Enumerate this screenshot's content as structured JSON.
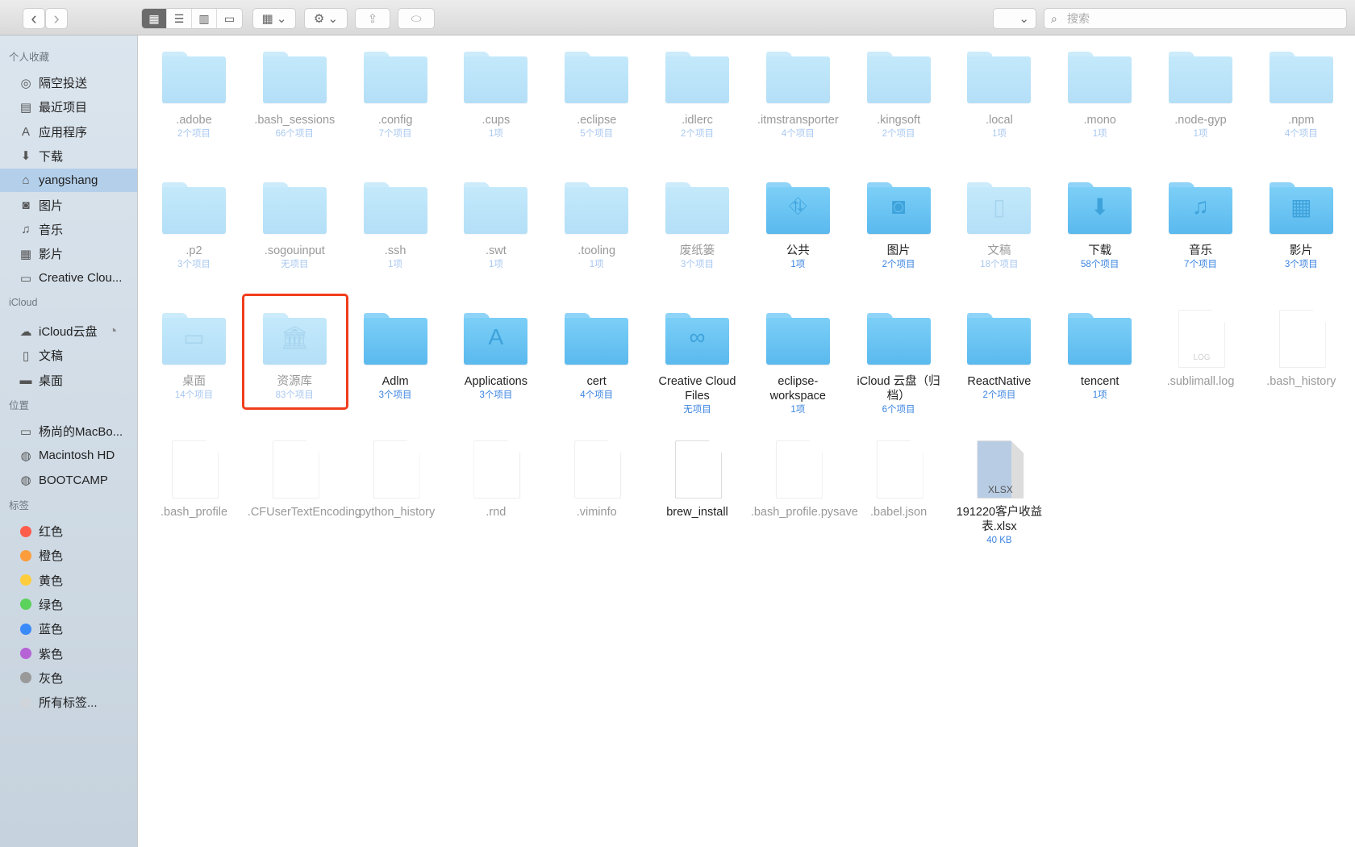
{
  "toolbar": {
    "back": "‹",
    "forward": "›",
    "views": [
      "icon-view",
      "list-view",
      "column-view",
      "gallery-view"
    ],
    "search_placeholder": "搜索"
  },
  "sidebar": {
    "sections": [
      {
        "title": "个人收藏",
        "items": [
          {
            "label": "隔空投送",
            "icon": "airdrop-icon",
            "glyph": "◎"
          },
          {
            "label": "最近项目",
            "icon": "recents-icon",
            "glyph": "▤"
          },
          {
            "label": "应用程序",
            "icon": "applications-icon",
            "glyph": "A"
          },
          {
            "label": "下载",
            "icon": "download-icon",
            "glyph": "⬇"
          },
          {
            "label": "yangshang",
            "icon": "home-icon",
            "glyph": "⌂",
            "selected": true
          },
          {
            "label": "图片",
            "icon": "camera-icon",
            "glyph": "◙"
          },
          {
            "label": "音乐",
            "icon": "music-icon",
            "glyph": "♫"
          },
          {
            "label": "影片",
            "icon": "film-icon",
            "glyph": "▦"
          },
          {
            "label": "Creative Clou...",
            "icon": "folder-icon",
            "glyph": "▭"
          }
        ]
      },
      {
        "title": "iCloud",
        "items": [
          {
            "label": "iCloud云盘",
            "icon": "cloud-icon",
            "glyph": "☁",
            "progress": true
          },
          {
            "label": "文稿",
            "icon": "document-icon",
            "glyph": "▯"
          },
          {
            "label": "桌面",
            "icon": "desktop-icon",
            "glyph": "▬"
          }
        ]
      },
      {
        "title": "位置",
        "items": [
          {
            "label": "杨尚的MacBo...",
            "icon": "laptop-icon",
            "glyph": "▭"
          },
          {
            "label": "Macintosh HD",
            "icon": "disk-icon",
            "glyph": "◍"
          },
          {
            "label": "BOOTCAMP",
            "icon": "disk-icon",
            "glyph": "◍"
          }
        ]
      },
      {
        "title": "标签",
        "items": [
          {
            "label": "红色",
            "color": "#fe5d4c"
          },
          {
            "label": "橙色",
            "color": "#fb9d3d"
          },
          {
            "label": "黄色",
            "color": "#fdcd3c"
          },
          {
            "label": "绿色",
            "color": "#5ad25b"
          },
          {
            "label": "蓝色",
            "color": "#3a8afa"
          },
          {
            "label": "紫色",
            "color": "#b663d6"
          },
          {
            "label": "灰色",
            "color": "#999999"
          },
          {
            "label": "所有标签...",
            "color": "#cfd5da"
          }
        ]
      }
    ]
  },
  "files": [
    {
      "name": ".adobe",
      "count": "2个项目",
      "kind": "folder",
      "dim": true
    },
    {
      "name": ".bash_sessions",
      "count": "66个项目",
      "kind": "folder",
      "dim": true
    },
    {
      "name": ".config",
      "count": "7个项目",
      "kind": "folder",
      "dim": true
    },
    {
      "name": ".cups",
      "count": "1项",
      "kind": "folder",
      "dim": true
    },
    {
      "name": ".eclipse",
      "count": "5个项目",
      "kind": "folder",
      "dim": true
    },
    {
      "name": ".idlerc",
      "count": "2个项目",
      "kind": "folder",
      "dim": true
    },
    {
      "name": ".itmstransporter",
      "count": "4个项目",
      "kind": "folder",
      "dim": true
    },
    {
      "name": ".kingsoft",
      "count": "2个项目",
      "kind": "folder",
      "dim": true
    },
    {
      "name": ".local",
      "count": "1项",
      "kind": "folder",
      "dim": true
    },
    {
      "name": ".mono",
      "count": "1项",
      "kind": "folder",
      "dim": true
    },
    {
      "name": ".node-gyp",
      "count": "1项",
      "kind": "folder",
      "dim": true
    },
    {
      "name": ".npm",
      "count": "4个项目",
      "kind": "folder",
      "dim": true
    },
    {
      "name": "",
      "count": "",
      "kind": "none"
    },
    {
      "name": ".p2",
      "count": "3个项目",
      "kind": "folder",
      "dim": true
    },
    {
      "name": ".sogouinput",
      "count": "无项目",
      "kind": "folder",
      "dim": true
    },
    {
      "name": ".ssh",
      "count": "1项",
      "kind": "folder",
      "dim": true
    },
    {
      "name": ".swt",
      "count": "1项",
      "kind": "folder",
      "dim": true
    },
    {
      "name": ".tooling",
      "count": "1项",
      "kind": "folder",
      "dim": true
    },
    {
      "name": "废纸篓",
      "count": "3个项目",
      "kind": "folder",
      "dim": true
    },
    {
      "name": "公共",
      "count": "1项",
      "kind": "folder",
      "glyph": "⛗",
      "icon": "public-folder-icon"
    },
    {
      "name": "图片",
      "count": "2个项目",
      "kind": "folder",
      "glyph": "◙",
      "icon": "pictures-folder-icon"
    },
    {
      "name": "文稿",
      "count": "18个项目",
      "kind": "folder",
      "dim": true,
      "glyph": "▯",
      "icon": "documents-folder-icon"
    },
    {
      "name": "下载",
      "count": "58个项目",
      "kind": "folder",
      "glyph": "⬇",
      "icon": "downloads-folder-icon"
    },
    {
      "name": "音乐",
      "count": "7个项目",
      "kind": "folder",
      "glyph": "♫",
      "icon": "music-folder-icon"
    },
    {
      "name": "影片",
      "count": "3个项目",
      "kind": "folder",
      "glyph": "▦",
      "icon": "movies-folder-icon"
    },
    {
      "name": "",
      "count": "",
      "kind": "none"
    },
    {
      "name": "桌面",
      "count": "14个项目",
      "kind": "folder",
      "dim": true,
      "glyph": "▭",
      "icon": "desktop-folder-icon"
    },
    {
      "name": "资源库",
      "count": "83个项目",
      "kind": "folder",
      "dim": true,
      "glyph": "🏛",
      "icon": "library-folder-icon",
      "highlight": true
    },
    {
      "name": "Adlm",
      "count": "3个项目",
      "kind": "folder"
    },
    {
      "name": "Applications",
      "count": "3个项目",
      "kind": "folder",
      "glyph": "A",
      "icon": "applications-folder-icon"
    },
    {
      "name": "cert",
      "count": "4个项目",
      "kind": "folder"
    },
    {
      "name": "Creative Cloud Files",
      "count": "无项目",
      "kind": "folder",
      "glyph": "∞",
      "icon": "creative-cloud-folder-icon"
    },
    {
      "name": "eclipse-workspace",
      "count": "1项",
      "kind": "folder"
    },
    {
      "name": "iCloud 云盘（归档）",
      "count": "6个项目",
      "kind": "folder"
    },
    {
      "name": "ReactNative",
      "count": "2个项目",
      "kind": "folder"
    },
    {
      "name": "tencent",
      "count": "1项",
      "kind": "folder"
    },
    {
      "name": ".sublimall.log",
      "count": "",
      "kind": "file",
      "dim": true,
      "ext": "LOG"
    },
    {
      "name": ".bash_history",
      "count": "",
      "kind": "file",
      "dim": true
    },
    {
      "name": "",
      "count": "",
      "kind": "none"
    },
    {
      "name": ".bash_profile",
      "count": "",
      "kind": "file",
      "dim": true
    },
    {
      "name": ".CFUserTextEncoding",
      "count": "",
      "kind": "file",
      "dim": true
    },
    {
      "name": ".python_history",
      "count": "",
      "kind": "file",
      "dim": true
    },
    {
      "name": ".rnd",
      "count": "",
      "kind": "file",
      "dim": true
    },
    {
      "name": ".viminfo",
      "count": "",
      "kind": "file",
      "dim": true
    },
    {
      "name": "brew_install",
      "count": "",
      "kind": "file"
    },
    {
      "name": ".bash_profile.pysave",
      "count": "",
      "kind": "file",
      "dim": true
    },
    {
      "name": ".babel.json",
      "count": "",
      "kind": "file",
      "dim": true
    },
    {
      "name": "191220客户收益表.xlsx",
      "count": "40 KB",
      "kind": "xlsx",
      "ext": "XLSX"
    }
  ]
}
